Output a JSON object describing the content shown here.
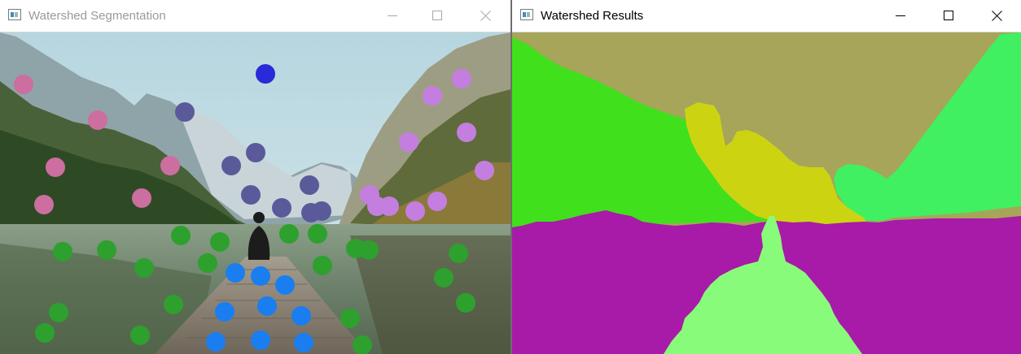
{
  "windows": [
    {
      "title": "Watershed Segmentation",
      "controls": [
        "minimize-icon",
        "maximize-icon",
        "close-icon"
      ]
    },
    {
      "title": "Watershed Results",
      "controls": [
        "minimize-icon",
        "maximize-icon",
        "close-icon"
      ]
    }
  ],
  "colors": {
    "sky_label": "#a7a55a",
    "left_mountain_label": "#40e01c",
    "right_mountain_label": "#40f060",
    "treeline_label": "#ccd412",
    "water_label": "#a81aa8",
    "person_dock_label": "#88fb7a",
    "marker_sky": "#2a2ad8",
    "marker_mountain_gray": "#5a5a9a",
    "marker_left_pink": "#cc6ea0",
    "marker_right_violet": "#c47ee0",
    "marker_green": "#2ea02e",
    "marker_blue": "#1a7ef0"
  }
}
